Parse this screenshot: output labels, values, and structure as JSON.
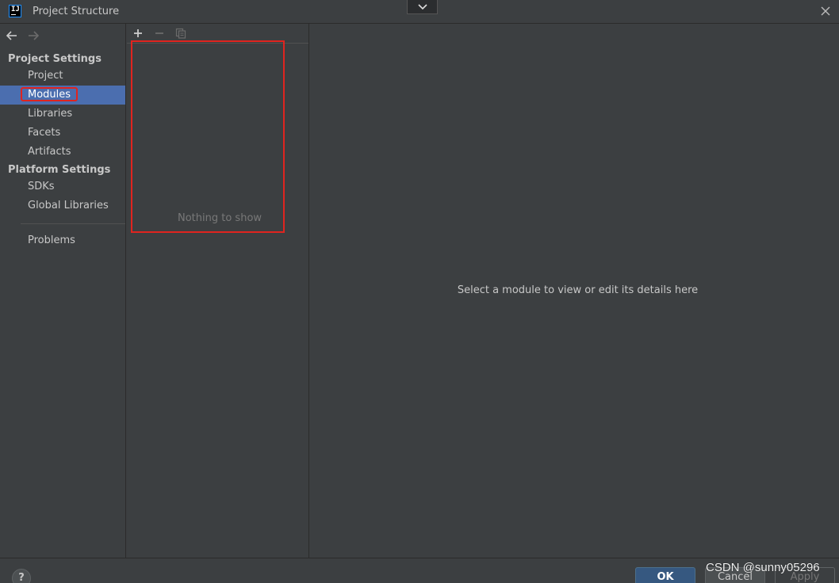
{
  "window": {
    "title": "Project Structure",
    "app_icon_text": "IJ"
  },
  "nav": {
    "back_icon": "arrow-left-icon",
    "forward_icon": "arrow-right-icon"
  },
  "sidebar": {
    "project_settings_title": "Project Settings",
    "project_items": [
      {
        "label": "Project"
      },
      {
        "label": "Modules",
        "selected": true
      },
      {
        "label": "Libraries"
      },
      {
        "label": "Facets"
      },
      {
        "label": "Artifacts"
      }
    ],
    "platform_settings_title": "Platform Settings",
    "platform_items": [
      {
        "label": "SDKs"
      },
      {
        "label": "Global Libraries"
      }
    ],
    "problems_label": "Problems"
  },
  "list_panel": {
    "empty_text": "Nothing to show"
  },
  "detail": {
    "hint": "Select a module to view or edit its details here"
  },
  "footer": {
    "help_label": "?",
    "ok_label": "OK",
    "cancel_label": "Cancel",
    "apply_label": "Apply"
  },
  "watermark": "CSDN @sunny05296",
  "colors": {
    "background": "#3c3f41",
    "selection": "#4b6eaf",
    "annotation_red": "#e0241f",
    "ok_button": "#365880"
  }
}
